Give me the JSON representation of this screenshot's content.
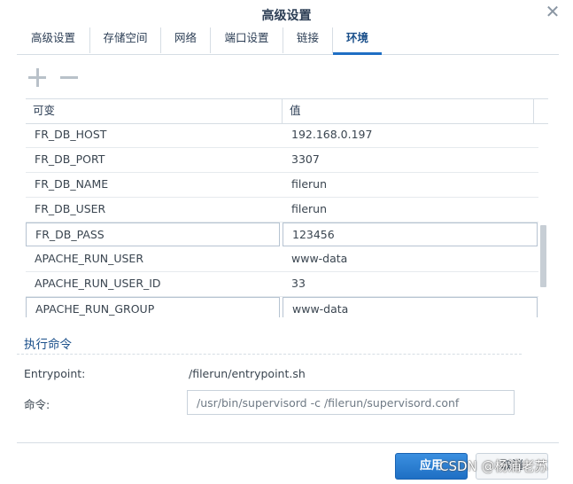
{
  "window": {
    "title": "高级设置",
    "close_icon": "close-icon"
  },
  "tabs": [
    {
      "label": "高级设置",
      "active": false
    },
    {
      "label": "存储空间",
      "active": false
    },
    {
      "label": "网络",
      "active": false
    },
    {
      "label": "端口设置",
      "active": false
    },
    {
      "label": "链接",
      "active": false
    },
    {
      "label": "环境",
      "active": true
    }
  ],
  "toolbar": {
    "add_icon": "plus-icon",
    "remove_icon": "minus-icon"
  },
  "env_table": {
    "headers": {
      "variable": "可变",
      "value": "值"
    },
    "rows": [
      {
        "variable": "FR_DB_HOST",
        "value": "192.168.0.197",
        "editing": false
      },
      {
        "variable": "FR_DB_PORT",
        "value": "3307",
        "editing": false
      },
      {
        "variable": "FR_DB_NAME",
        "value": "filerun",
        "editing": false
      },
      {
        "variable": "FR_DB_USER",
        "value": "filerun",
        "editing": false
      },
      {
        "variable": "FR_DB_PASS",
        "value": "123456",
        "editing": true
      },
      {
        "variable": "APACHE_RUN_USER",
        "value": "www-data",
        "editing": false
      },
      {
        "variable": "APACHE_RUN_USER_ID",
        "value": "33",
        "editing": false
      },
      {
        "variable": "APACHE_RUN_GROUP",
        "value": "www-data",
        "editing": true
      }
    ]
  },
  "command_section": {
    "title": "执行命令",
    "entrypoint_label": "Entrypoint:",
    "entrypoint_value": "/filerun/entrypoint.sh",
    "command_label": "命令:",
    "command_value": "/usr/bin/supervisord -c /filerun/supervisord.conf"
  },
  "footer": {
    "apply_label": "应用",
    "cancel_label": "取消"
  },
  "watermark": "CSDN @杨浦老苏",
  "colors": {
    "accent": "#1f6fc4",
    "title_text": "#2c3e55",
    "section_text": "#1a4f8a"
  }
}
